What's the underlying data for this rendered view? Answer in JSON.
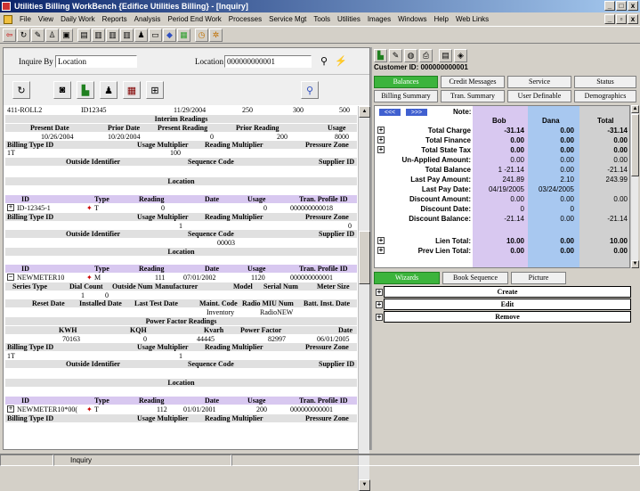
{
  "window": {
    "title": "Utilities Billing WorkBench {Edifice Utilities Billing} - [Inquiry]"
  },
  "menu": [
    "File",
    "View",
    "Daily Work",
    "Reports",
    "Analysis",
    "Period End Work",
    "Processes",
    "Service Mgt",
    "Tools",
    "Utilities",
    "Images",
    "Windows",
    "Help",
    "Web Links"
  ],
  "inquiry": {
    "inquire_by_label": "Inquire By",
    "inquire_by_value": "Location",
    "location_label": "Location",
    "location_value": "000000000001"
  },
  "report": {
    "first_row": [
      "411-ROLL2",
      "ID12345",
      "11/29/2004",
      "250",
      "300",
      "500"
    ],
    "interim_title": "Interim Readings",
    "interim_headers": [
      "Present Date",
      "Prior Date",
      "Present Reading",
      "Prior Reading",
      "Usage"
    ],
    "interim_values": [
      "10/26/2004",
      "10/20/2004",
      "0",
      "200",
      "8000"
    ],
    "billing_headers": [
      "Billing Type ID",
      "Usage Multiplier",
      "Reading Multiplier",
      "Pressure Zone"
    ],
    "billing_values_1": [
      "1T",
      "100",
      "",
      ""
    ],
    "outside_headers": [
      "Outside Identifier",
      "Sequence Code",
      "Supplier ID"
    ],
    "location_title": "Location",
    "meter_headers": [
      "ID",
      "Type",
      "Reading",
      "Date",
      "Usage",
      "Tran. Profile ID"
    ],
    "meter1": [
      "ID-12345-1",
      "T",
      "0",
      "",
      "0",
      "000000000018"
    ],
    "billing_values_2": [
      "",
      "1",
      "",
      "0"
    ],
    "seq_value_2": "00003",
    "meter2": [
      "NEWMETER10",
      "M",
      "111",
      "07/01/2002",
      "1120",
      "000000000001"
    ],
    "meter_detail_headers": [
      "Series Type",
      "Dial Count",
      "Outside Num",
      "Manufacturer",
      "Model",
      "Serial Num",
      "Meter Size"
    ],
    "meter_detail_values": [
      "",
      "1",
      "0",
      "",
      "",
      "",
      ""
    ],
    "meter_detail_headers2": [
      "Reset Date",
      "Installed Date",
      "Last Test Date",
      "Maint. Code",
      "Radio MIU Num",
      "Batt. Inst. Date"
    ],
    "meter_detail_values2": [
      "",
      "",
      "",
      "Inventory",
      "RadioNEW",
      ""
    ],
    "pf_title": "Power Factor Readings",
    "pf_headers": [
      "KWH",
      "KQH",
      "Kvarh",
      "Power Factor",
      "Date"
    ],
    "pf_values": [
      "70163",
      "0",
      "44445",
      "82997",
      "06/01/2005"
    ],
    "billing_values_3": [
      "1T",
      "1",
      "",
      ""
    ],
    "meter3": [
      "NEWMETER10*00(",
      "T",
      "112",
      "01/01/2001",
      "200",
      "000000000001"
    ]
  },
  "right": {
    "customer_id": "Customer ID: 000000000001",
    "tabs_row1": [
      "Balances",
      "Credit Messages",
      "Service",
      "Status"
    ],
    "tabs_row2": [
      "Billing Summary",
      "Tran. Summary",
      "User Definable",
      "Demographics"
    ],
    "nav_prev": "<<<",
    "nav_next": ">>>",
    "note_label": "Note:",
    "col_headers": [
      "Bob",
      "Dana",
      "Total"
    ],
    "rows": [
      {
        "label": "Total Charge",
        "plus": true,
        "vals": [
          "-31.14",
          "0.00",
          "-31.14"
        ],
        "bold": true
      },
      {
        "label": "Total Finance",
        "plus": true,
        "vals": [
          "0.00",
          "0.00",
          "0.00"
        ],
        "bold": true
      },
      {
        "label": "Total State Tax",
        "plus": true,
        "vals": [
          "0.00",
          "0.00",
          "0.00"
        ],
        "bold": true
      },
      {
        "label": "Un-Applied Amount:",
        "plus": false,
        "vals": [
          "0.00",
          "0.00",
          "0.00"
        ],
        "bold": false
      },
      {
        "label": "Total Balance",
        "plus": false,
        "vals": [
          "1    -21.14",
          "0.00",
          "-21.14"
        ],
        "bold": false
      },
      {
        "label": "Last Pay Amount:",
        "plus": false,
        "vals": [
          "241.89",
          "2.10",
          "243.99"
        ],
        "bold": false
      },
      {
        "label": "Last Pay Date:",
        "plus": false,
        "vals": [
          "04/19/2005",
          "03/24/2005",
          ""
        ],
        "bold": false
      },
      {
        "label": "Discount Amount:",
        "plus": false,
        "vals": [
          "0.00",
          "0.00",
          "0.00"
        ],
        "bold": false
      },
      {
        "label": "Discount Date:",
        "plus": false,
        "vals": [
          "0",
          "0",
          ""
        ],
        "bold": false
      },
      {
        "label": "Discount Balance:",
        "plus": false,
        "vals": [
          "-21.14",
          "0.00",
          "-21.14"
        ],
        "bold": false
      }
    ],
    "lien_rows": [
      {
        "label": "Lien Total:",
        "vals": [
          "10.00",
          "0.00",
          "10.00"
        ]
      },
      {
        "label": "Prev Lien Total:",
        "vals": [
          "0.00",
          "0.00",
          "0.00"
        ]
      }
    ],
    "bottom_tabs": [
      "Wizards",
      "Book Sequence",
      "Picture"
    ],
    "wizard_items": [
      "Create",
      "Edit",
      "Remove"
    ]
  },
  "status": {
    "text": "Inquiry"
  }
}
